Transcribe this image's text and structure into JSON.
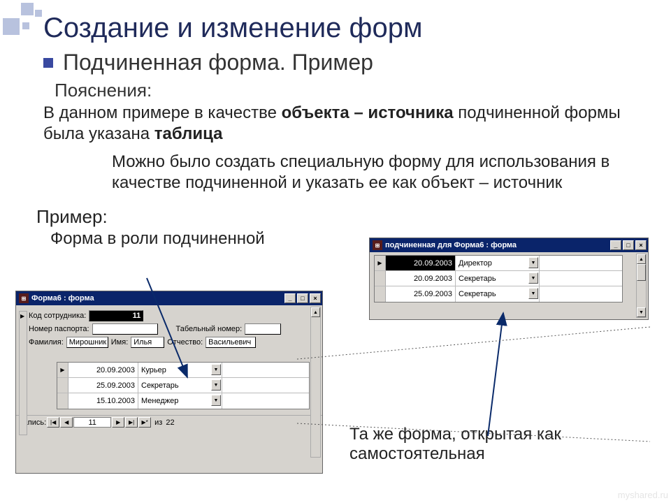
{
  "slide": {
    "title": "Создание и изменение форм",
    "subtitle": "Подчиненная форма. Пример",
    "explain_label": "Пояснения:",
    "para1_pre": "В данном примере в качестве ",
    "para1_b1": "объекта – источника",
    "para1_mid": " подчиненной формы была указана ",
    "para1_b2": "таблица",
    "para2": "Можно было создать специальную форму для использования в качестве подчиненной и указать ее как объект – источник",
    "example_label": "Пример:",
    "caption_inline": "Форма в роли подчиненной",
    "caption2": "Та же форма, открытая как самостоятельная"
  },
  "main_window": {
    "title": "Форма6 : форма",
    "titlebar_icon_glyph": "⊞",
    "btn_min": "_",
    "btn_max": "□",
    "btn_close": "×",
    "labels": {
      "code": "Код сотрудника:",
      "passport": "Номер паспорта:",
      "tabnum": "Табельный номер:",
      "lastname": "Фамилия:",
      "firstname": "Имя:",
      "patronymic": "Отчество:"
    },
    "values": {
      "code": "11",
      "passport": "",
      "tabnum": "",
      "lastname": "Мирошник",
      "firstname": "Илья",
      "patronymic": "Васильевич"
    },
    "subrows": [
      {
        "date": "20.09.2003",
        "role": "Курьер"
      },
      {
        "date": "25.09.2003",
        "role": "Секретарь"
      },
      {
        "date": "15.10.2003",
        "role": "Менеджер"
      }
    ],
    "recnav": {
      "label": "Запись:",
      "first": "|◀",
      "prev": "◀",
      "current": "11",
      "next": "▶",
      "last": "▶|",
      "new": "▶*",
      "of_label": "из",
      "total": "22"
    }
  },
  "sub_window": {
    "title": "подчиненная для Форма6 : форма",
    "titlebar_icon_glyph": "⊞",
    "btn_min": "_",
    "btn_max": "□",
    "btn_close": "×",
    "rows": [
      {
        "date": "20.09.2003",
        "role": "Директор"
      },
      {
        "date": "20.09.2003",
        "role": "Секретарь"
      },
      {
        "date": "25.09.2003",
        "role": "Секретарь"
      }
    ]
  },
  "watermark": "myshared.ru"
}
